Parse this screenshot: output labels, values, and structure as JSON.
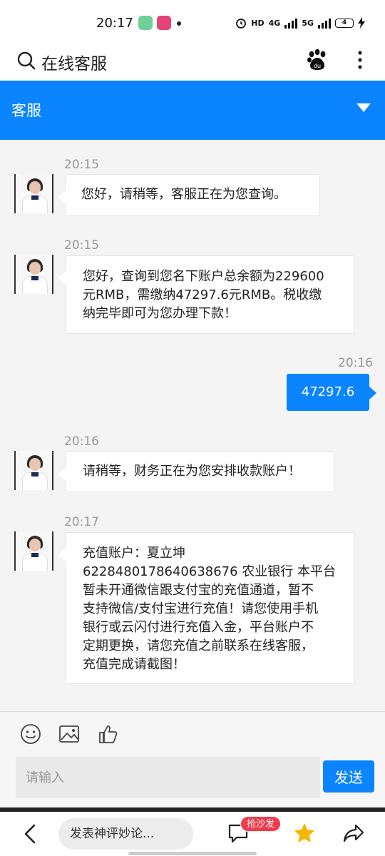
{
  "status_bar": {
    "time": "20:17",
    "network_labels": [
      "HD",
      "4G",
      "5G"
    ],
    "battery": "4"
  },
  "search_bar": {
    "title": "在线客服"
  },
  "header": {
    "title": "客服"
  },
  "messages": [
    {
      "side": "left",
      "time": "20:15",
      "text": "您好，请稍等，客服正在为您查询。"
    },
    {
      "side": "left",
      "time": "20:15",
      "lines": [
        "您好，查询到您名下账户总余额为229600",
        "元RMB，需缴纳47297.6元RMB。税收缴",
        "纳完毕即可为您办理下款！"
      ]
    },
    {
      "side": "right",
      "time": "20:16",
      "text": "47297.6"
    },
    {
      "side": "left",
      "time": "20:16",
      "text": "请稍等，财务正在为您安排收款账户！"
    },
    {
      "side": "left",
      "time": "20:17",
      "lines": [
        "充值账户：夏立坤",
        "6228480178640638676 农业银行 本平台",
        "暂未开通微信跟支付宝的充值通道，暂不",
        "支持微信/支付宝进行充值！请您使用手机",
        "银行或云闪付进行充值入金，平台账户不",
        "定期更换，请您充值之前联系在线客服，",
        "充值完成请截图！"
      ]
    }
  ],
  "composer": {
    "placeholder": "请输入",
    "send_label": "发送"
  },
  "bottom_bar": {
    "comment_placeholder": "发表神评妙论...",
    "sofa_badge": "抢沙发"
  },
  "colors": {
    "accent": "#0a84ff",
    "badge": "#f23a4d",
    "star": "#f5b400"
  }
}
